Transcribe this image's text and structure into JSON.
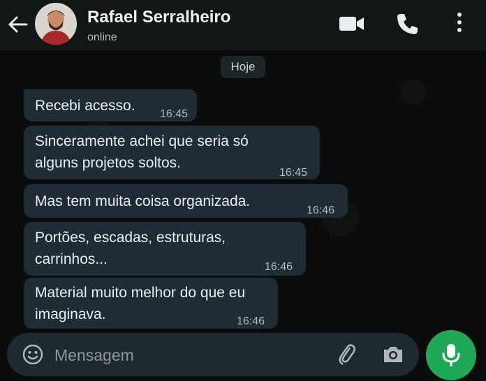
{
  "header": {
    "name": "Rafael Serralheiro",
    "status": "online"
  },
  "chat": {
    "date_label": "Hoje",
    "messages": [
      {
        "text": "Recebi acesso.",
        "time": "16:45"
      },
      {
        "text": "Sinceramente achei que seria só alguns projetos soltos.",
        "time": "16:45"
      },
      {
        "text": "Mas tem muita coisa organizada.",
        "time": "16:46"
      },
      {
        "text": "Portões, escadas, estruturas, carrinhos...",
        "time": "16:46"
      },
      {
        "text": "Material muito melhor do que eu imaginava.",
        "time": "16:46"
      }
    ]
  },
  "composer": {
    "placeholder": "Mensagem"
  },
  "colors": {
    "header_bg": "#111715",
    "chat_bg": "#0b0d0c",
    "bubble_bg": "#202c33",
    "mic_button": "#1fa855"
  },
  "icons": {
    "back": "back-arrow-icon",
    "video": "video-camera-icon",
    "call": "phone-icon",
    "menu": "more-vertical-icon",
    "emoji": "emoji-icon",
    "attach": "paperclip-icon",
    "camera": "camera-icon",
    "mic": "microphone-icon"
  }
}
